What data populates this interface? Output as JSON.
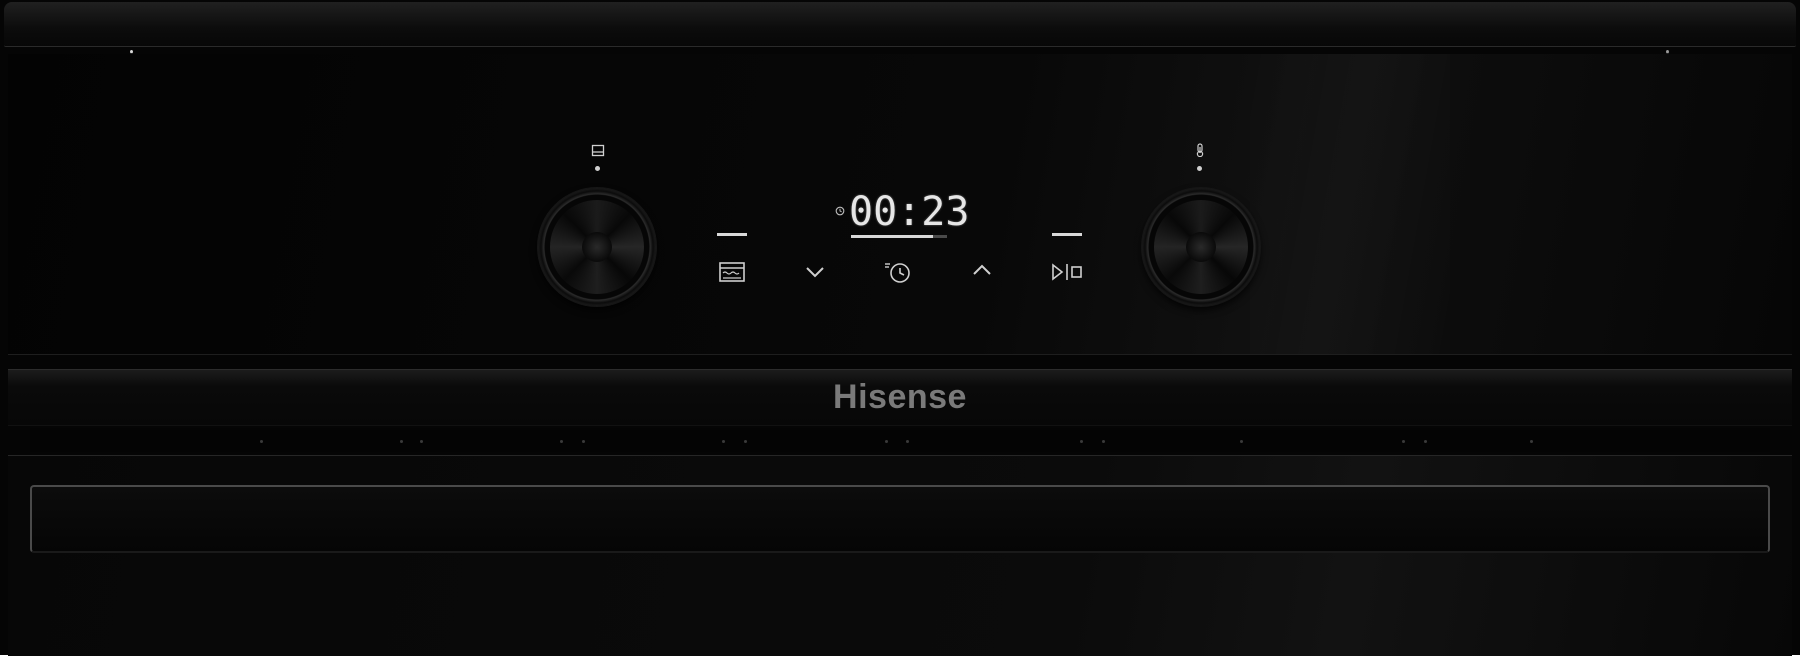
{
  "appliance": {
    "brand": "Hisense"
  },
  "display": {
    "time": "00:23",
    "progress": 0.85
  },
  "controls": {
    "left_knob": {
      "icon": "oven-mode-icon"
    },
    "right_knob": {
      "icon": "thermometer-icon"
    },
    "buttons": [
      {
        "icon": "oven-function-icon"
      },
      {
        "icon": "chevron-down-icon"
      },
      {
        "icon": "timer-clock-icon"
      },
      {
        "icon": "chevron-up-icon"
      },
      {
        "icon": "start-stop-icon"
      }
    ]
  },
  "colors": {
    "body": "#050505",
    "display_text": "#e6e6e6",
    "brand_text": "#7a7a7a"
  }
}
